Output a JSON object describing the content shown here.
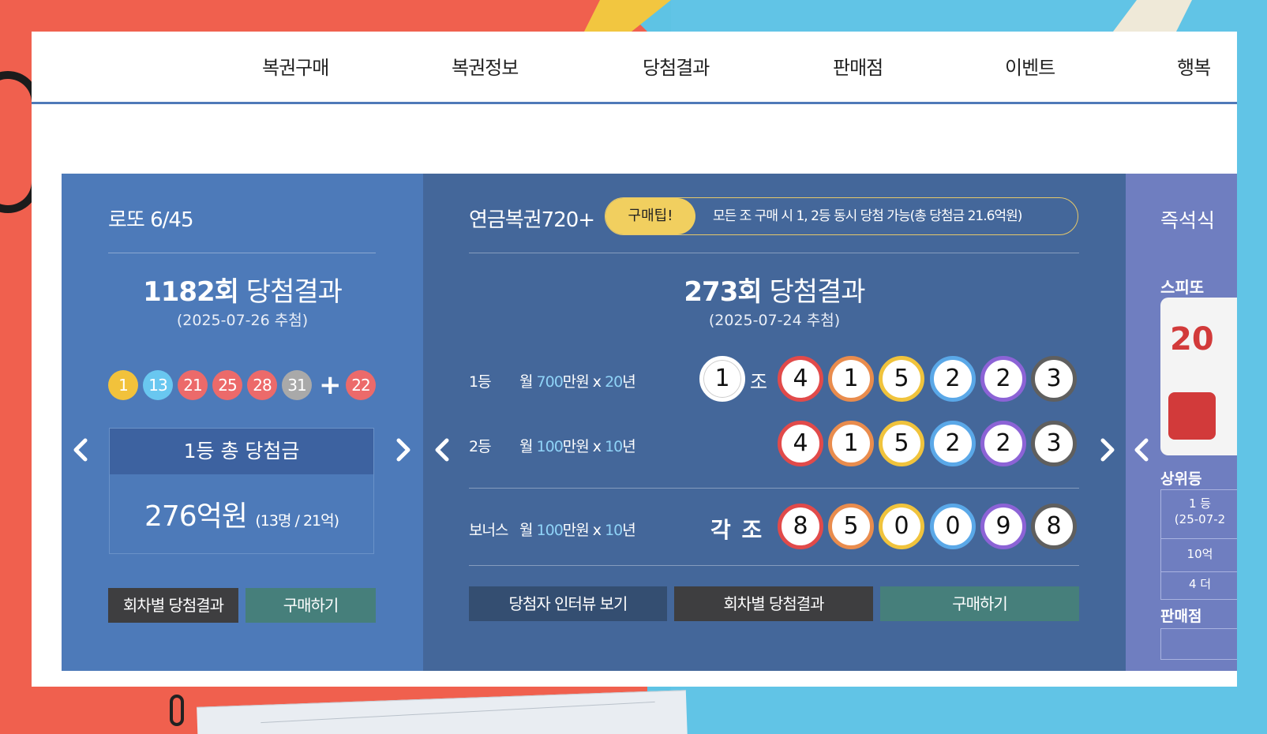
{
  "nav": {
    "items": [
      "복권구매",
      "복권정보",
      "당첨결과",
      "판매점",
      "이벤트",
      "행복"
    ]
  },
  "lotto": {
    "title": "로또 6/45",
    "round_number": "1182회",
    "round_suffix": " 당첨결과",
    "draw_date": "(2025-07-26 추첨)",
    "balls": [
      {
        "value": "1",
        "color": "#f2c23b"
      },
      {
        "value": "13",
        "color": "#69c7f0"
      },
      {
        "value": "21",
        "color": "#ec6a6a"
      },
      {
        "value": "25",
        "color": "#ec6a6a"
      },
      {
        "value": "28",
        "color": "#ec6a6a"
      },
      {
        "value": "31",
        "color": "#a9a9a9"
      }
    ],
    "plus": "+",
    "bonus": {
      "value": "22",
      "color": "#ec6a6a"
    },
    "prize_label": "1등 총 당첨금",
    "prize_amount": "276억원",
    "prize_detail": "(13명 / 21억)",
    "btn_results": "회차별 당첨결과",
    "btn_buy": "구매하기"
  },
  "pension": {
    "title": "연금복권720+",
    "tip_badge": "구매팁!",
    "tip_text": "모든 조 구매 시 1, 2등 동시 당첨 가능(총 당첨금 21.6억원)",
    "round_number": "273회",
    "round_suffix": " 당첨결과",
    "draw_date": "(2025-07-24 추첨)",
    "rank1": {
      "label": "1등",
      "desc_pre": "월 ",
      "amount": "700",
      "desc_mid": "만원 x ",
      "years": "20",
      "desc_post": "년",
      "group": "1",
      "group_suffix": "조",
      "numbers": [
        "4",
        "1",
        "5",
        "2",
        "2",
        "3"
      ]
    },
    "rank2": {
      "label": "2등",
      "desc_pre": "월 ",
      "amount": "100",
      "desc_mid": "만원 x ",
      "years": "10",
      "desc_post": "년",
      "numbers": [
        "4",
        "1",
        "5",
        "2",
        "2",
        "3"
      ]
    },
    "bonus": {
      "label": "보너스",
      "desc_pre": "월 ",
      "amount": "100",
      "desc_mid": "만원 x ",
      "years": "10",
      "desc_post": "년",
      "group_text": "각 조",
      "numbers": [
        "8",
        "5",
        "0",
        "0",
        "9",
        "8"
      ]
    },
    "ball_ring_colors": [
      "#e14a4a",
      "#e98c4d",
      "#f0c33c",
      "#5aa8e8",
      "#8c63d6",
      "#5f5f5f"
    ],
    "btn_interview": "당첨자 인터뷰 보기",
    "btn_results": "회차별 당첨결과",
    "btn_buy": "구매하기"
  },
  "instant": {
    "title": "즉석식",
    "subtitle": "스피또",
    "card_text": "20",
    "section1": "상위등",
    "rows": [
      "1 등",
      "(25-07-2",
      "10억",
      "4 더"
    ],
    "section2": "판매점"
  }
}
